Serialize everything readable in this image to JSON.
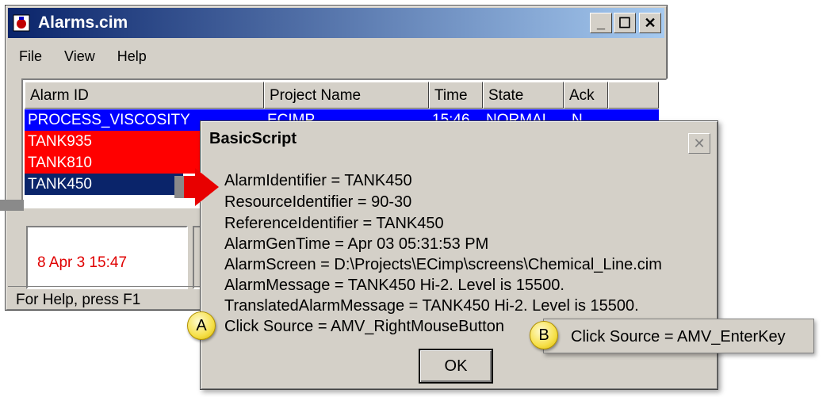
{
  "alarms_window": {
    "title": "Alarms.cim",
    "menu": [
      "File",
      "View",
      "Help"
    ],
    "columns": [
      "Alarm ID",
      "Project Name",
      "Time",
      "State",
      "Ack"
    ],
    "rows": [
      {
        "alarm_id": "PROCESS_VISCOSITY",
        "project": "ECIMP",
        "time": "15:46",
        "state": "NORMAL",
        "ack": "N",
        "bg": "#0000ff"
      },
      {
        "alarm_id": "TANK935",
        "bg": "#ff0000"
      },
      {
        "alarm_id": "TANK810",
        "bg": "#ff0000"
      },
      {
        "alarm_id": "TANK450",
        "bg": "#0a246a"
      }
    ],
    "date_display": "8 Apr 3 15:47",
    "status_text": "For Help, press F1"
  },
  "dialog": {
    "title": "BasicScript",
    "lines": [
      "AlarmIdentifier = TANK450",
      "ResourceIdentifier = 90-30",
      "ReferenceIdentifier = TANK450",
      "AlarmGenTime = Apr 03 05:31:53 PM",
      "AlarmScreen = D:\\Projects\\ECimp\\screens\\Chemical_Line.cim",
      "AlarmMessage = TANK450 Hi-2. Level is 15500.",
      "TranslatedAlarmMessage = TANK450 Hi-2. Level is 15500.",
      "Click Source = AMV_RightMouseButton"
    ],
    "ok_label": "OK"
  },
  "callouts": {
    "a_label": "A",
    "b_label": "B",
    "b_text": "Click Source = AMV_EnterKey"
  },
  "colors": {
    "title_start": "#0a246a",
    "title_end": "#a6caf0",
    "alarm_red": "#ff0000",
    "date_text": "#e00000",
    "badge_yellow": "#f6e04a"
  }
}
